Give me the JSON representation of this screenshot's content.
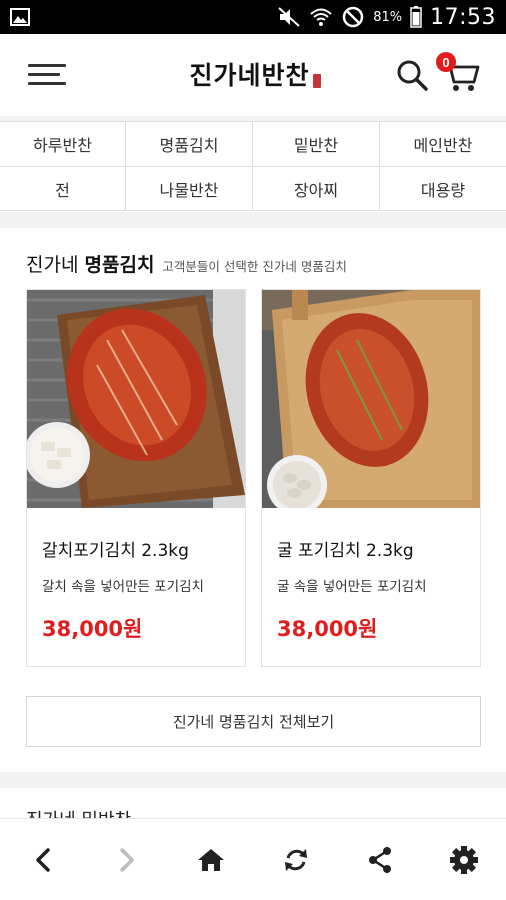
{
  "status_bar": {
    "battery_percent": "81%",
    "time": "17:53",
    "icons": [
      "gallery-icon",
      "mute-icon",
      "wifi-icon",
      "do-not-disturb-icon",
      "battery-icon"
    ]
  },
  "header": {
    "logo_text": "진가네반찬",
    "cart_count": "0",
    "icons": [
      "menu-icon",
      "search-icon",
      "cart-icon"
    ]
  },
  "categories": [
    {
      "label": "하루반찬"
    },
    {
      "label": "명품김치"
    },
    {
      "label": "밑반찬"
    },
    {
      "label": "메인반찬"
    },
    {
      "label": "전"
    },
    {
      "label": "나물반찬"
    },
    {
      "label": "장아찌"
    },
    {
      "label": "대용량"
    }
  ],
  "section": {
    "title_prefix": "진가네",
    "title_bold": "명품김치",
    "subtitle": "고객분들이 선택한 진가네 명품김치",
    "view_all_label": "진가네 명품김치 전체보기",
    "next_section_peek": "진가네 밑반찬"
  },
  "products": [
    {
      "name": "갈치포기김치 2.3kg",
      "description": "갈치 속을 넣어만든 포기김치",
      "price": "38,000원"
    },
    {
      "name": "굴 포기김치 2.3kg",
      "description": "굴 속을 넣어만든 포기김치",
      "price": "38,000원"
    }
  ],
  "colors": {
    "accent_red": "#e01e1e",
    "border": "#dcdcdc",
    "band_gray": "#f2f2f2"
  },
  "bottom_nav": {
    "icons": [
      "back-icon",
      "forward-icon",
      "home-icon",
      "refresh-icon",
      "share-icon",
      "settings-icon"
    ]
  }
}
